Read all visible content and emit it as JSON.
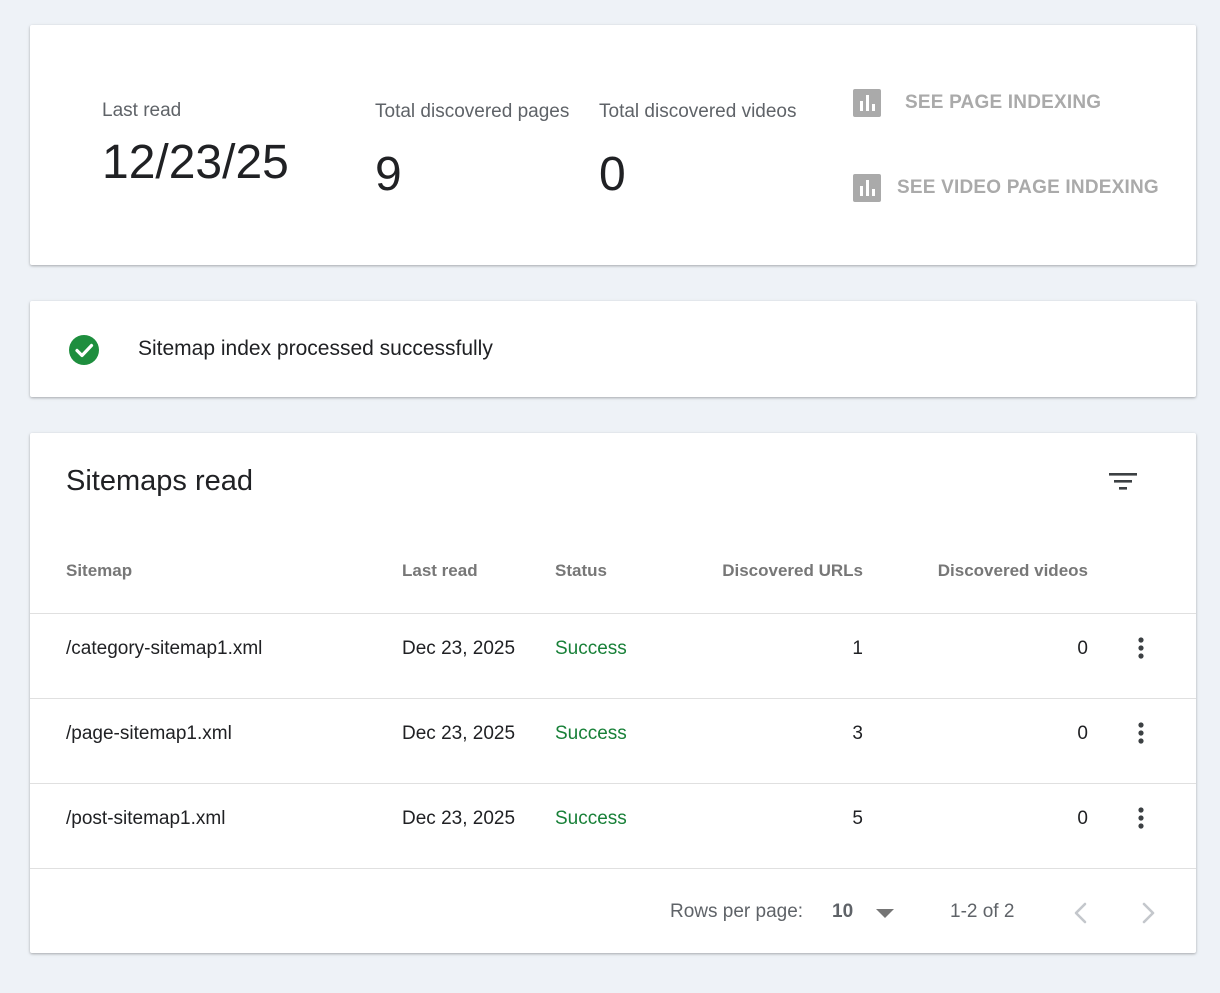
{
  "summary": {
    "last_read_label": "Last read",
    "last_read_value": "12/23/25",
    "pages_label": "Total discovered pages",
    "pages_value": "9",
    "videos_label": "Total discovered videos",
    "videos_value": "0",
    "see_page_indexing": "SEE PAGE INDEXING",
    "see_video_indexing": "SEE VIDEO PAGE INDEXING",
    "chart_icon": "bar-chart-icon",
    "link_color": "#aaaaaa"
  },
  "status": {
    "icon": "check-circle-icon",
    "message": "Sitemap index processed successfully",
    "color": "#1e8e3e"
  },
  "table": {
    "title": "Sitemaps read",
    "filter_icon": "filter-icon",
    "headers": {
      "sitemap": "Sitemap",
      "last_read": "Last read",
      "status": "Status",
      "urls": "Discovered URLs",
      "videos": "Discovered videos"
    },
    "rows": [
      {
        "sitemap": "/category-sitemap1.xml",
        "last_read": "Dec 23, 2025",
        "status": "Success",
        "urls": "1",
        "videos": "0"
      },
      {
        "sitemap": "/page-sitemap1.xml",
        "last_read": "Dec 23, 2025",
        "status": "Success",
        "urls": "3",
        "videos": "0"
      },
      {
        "sitemap": "/post-sitemap1.xml",
        "last_read": "Dec 23, 2025",
        "status": "Success",
        "urls": "5",
        "videos": "0"
      }
    ],
    "row_menu_icon": "more-vert-icon",
    "success_color": "#188038"
  },
  "pagination": {
    "rows_per_page_label": "Rows per page:",
    "rows_per_page_value": "10",
    "range": "1-2 of 2",
    "prev_icon": "chevron-left-icon",
    "next_icon": "chevron-right-icon"
  }
}
